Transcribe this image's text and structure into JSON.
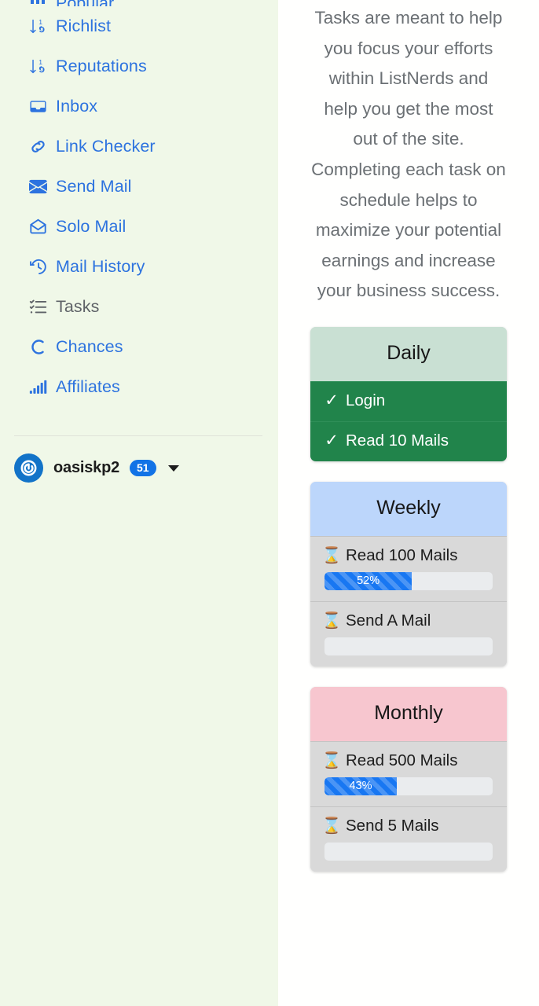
{
  "sidebar": {
    "clipped_top_item": {
      "label": "Popular",
      "icon": "chart-icon"
    },
    "items": [
      {
        "label": "Richlist",
        "icon": "sort-numeric-down-icon",
        "active": false
      },
      {
        "label": "Reputations",
        "icon": "sort-numeric-down-icon",
        "active": false
      },
      {
        "label": "Inbox",
        "icon": "inbox-icon",
        "active": false
      },
      {
        "label": "Link Checker",
        "icon": "link-icon",
        "active": false
      },
      {
        "label": "Send Mail",
        "icon": "envelope-filled-icon",
        "active": false
      },
      {
        "label": "Solo Mail",
        "icon": "envelope-open-icon",
        "active": false
      },
      {
        "label": "Mail History",
        "icon": "clock-history-icon",
        "active": false
      },
      {
        "label": "Tasks",
        "icon": "task-list-icon",
        "active": true
      },
      {
        "label": "Chances",
        "icon": "c-circle-icon",
        "active": false
      },
      {
        "label": "Affiliates",
        "icon": "bar-chart-icon",
        "active": false
      }
    ],
    "user": {
      "name": "oasiskp2",
      "level_badge": "51",
      "avatar_icon": "power-circle-avatar-icon",
      "caret_icon": "chevron-down-icon"
    }
  },
  "main": {
    "intro_text": "Tasks are meant to help you focus your efforts within ListNerds and help you get the most out of the site. Completing each task on schedule helps to maximize your potential earnings and increase your business success.",
    "cards": [
      {
        "title": "Daily",
        "accent": "#c9e0d3",
        "tasks": [
          {
            "label": "Login",
            "status": "done",
            "icon": "check-icon",
            "progress": null
          },
          {
            "label": "Read 10 Mails",
            "status": "done",
            "icon": "check-icon",
            "progress": null
          }
        ]
      },
      {
        "title": "Weekly",
        "accent": "#bcd6fb",
        "tasks": [
          {
            "label": "Read 100 Mails",
            "status": "pending",
            "icon": "hourglass-icon",
            "progress": 52,
            "progress_label": "52%"
          },
          {
            "label": "Send A Mail",
            "status": "pending",
            "icon": "hourglass-icon",
            "progress": 0,
            "progress_label": ""
          }
        ]
      },
      {
        "title": "Monthly",
        "accent": "#f7c6cf",
        "tasks": [
          {
            "label": "Read 500 Mails",
            "status": "pending",
            "icon": "hourglass-icon",
            "progress": 43,
            "progress_label": "43%"
          },
          {
            "label": "Send 5 Mails",
            "status": "pending",
            "icon": "hourglass-icon",
            "progress": 0,
            "progress_label": ""
          }
        ]
      }
    ]
  },
  "colors": {
    "sidebar_bg": "#f0f8e8",
    "link_blue": "#2d73df",
    "badge_blue": "#1273e6",
    "done_green": "#21844b",
    "progress_blue": "#1877f2",
    "muted_text": "#6b7074"
  }
}
